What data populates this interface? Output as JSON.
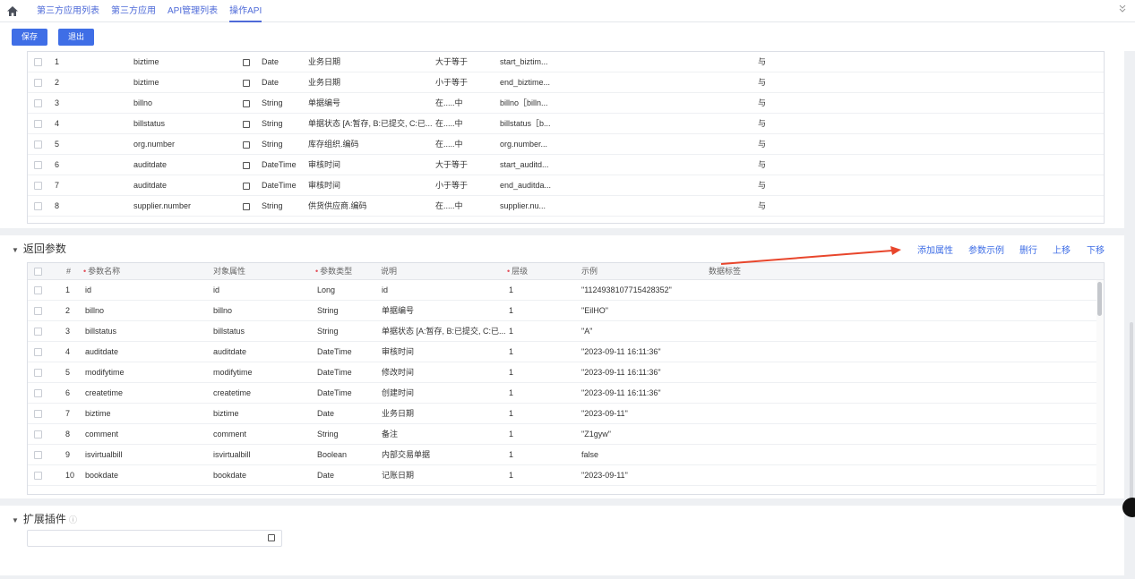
{
  "nav": {
    "tabs": [
      "第三方应用列表",
      "第三方应用",
      "API管理列表",
      "操作API"
    ]
  },
  "toolbar": {
    "save_label": "保存",
    "exit_label": "退出"
  },
  "request_rows": [
    {
      "idx": "1",
      "field": "biztime",
      "type": "Date",
      "desc": "业务日期",
      "op": "大于等于",
      "param": "start_biztim...",
      "logic": "与"
    },
    {
      "idx": "2",
      "field": "biztime",
      "type": "Date",
      "desc": "业务日期",
      "op": "小于等于",
      "param": "end_biztime...",
      "logic": "与"
    },
    {
      "idx": "3",
      "field": "billno",
      "type": "String",
      "desc": "单据编号",
      "op": "在.....中",
      "param": "billno［billn...",
      "logic": "与"
    },
    {
      "idx": "4",
      "field": "billstatus",
      "type": "String",
      "desc": "单据状态 [A:暂存, B:已提交, C:已...",
      "op": "在.....中",
      "param": "billstatus［b...",
      "logic": "与"
    },
    {
      "idx": "5",
      "field": "org.number",
      "type": "String",
      "desc": "库存组织.编码",
      "op": "在.....中",
      "param": "org.number...",
      "logic": "与"
    },
    {
      "idx": "6",
      "field": "auditdate",
      "type": "DateTime",
      "desc": "审核时间",
      "op": "大于等于",
      "param": "start_auditd...",
      "logic": "与"
    },
    {
      "idx": "7",
      "field": "auditdate",
      "type": "DateTime",
      "desc": "审核时间",
      "op": "小于等于",
      "param": "end_auditda...",
      "logic": "与"
    },
    {
      "idx": "8",
      "field": "supplier.number",
      "type": "String",
      "desc": "供货供应商.编码",
      "op": "在.....中",
      "param": "supplier.nu...",
      "logic": "与"
    }
  ],
  "return_section": {
    "title": "返回参数",
    "actions": [
      "添加属性",
      "参数示例",
      "删行",
      "上移",
      "下移"
    ],
    "columns": {
      "index": "#",
      "name": "参数名称",
      "obj_attr": "对象属性",
      "type": "参数类型",
      "desc": "说明",
      "level": "层级",
      "example": "示例",
      "tag": "数据标签"
    },
    "rows": [
      {
        "idx": "1",
        "name": "id",
        "attr": "id",
        "type": "Long",
        "desc": "id",
        "level": "1",
        "example": "\"1124938107715428352\""
      },
      {
        "idx": "2",
        "name": "billno",
        "attr": "billno",
        "type": "String",
        "desc": "单据编号",
        "level": "1",
        "example": "\"EilHO\""
      },
      {
        "idx": "3",
        "name": "billstatus",
        "attr": "billstatus",
        "type": "String",
        "desc": "单据状态 [A:暂存, B:已提交, C:已...",
        "level": "1",
        "example": "\"A\""
      },
      {
        "idx": "4",
        "name": "auditdate",
        "attr": "auditdate",
        "type": "DateTime",
        "desc": "审核时间",
        "level": "1",
        "example": "\"2023-09-11 16:11:36\""
      },
      {
        "idx": "5",
        "name": "modifytime",
        "attr": "modifytime",
        "type": "DateTime",
        "desc": "修改时间",
        "level": "1",
        "example": "\"2023-09-11 16:11:36\""
      },
      {
        "idx": "6",
        "name": "createtime",
        "attr": "createtime",
        "type": "DateTime",
        "desc": "创建时间",
        "level": "1",
        "example": "\"2023-09-11 16:11:36\""
      },
      {
        "idx": "7",
        "name": "biztime",
        "attr": "biztime",
        "type": "Date",
        "desc": "业务日期",
        "level": "1",
        "example": "\"2023-09-11\""
      },
      {
        "idx": "8",
        "name": "comment",
        "attr": "comment",
        "type": "String",
        "desc": "备注",
        "level": "1",
        "example": "\"Z1gyw\""
      },
      {
        "idx": "9",
        "name": "isvirtualbill",
        "attr": "isvirtualbill",
        "type": "Boolean",
        "desc": "内部交易单据",
        "level": "1",
        "example": "false"
      },
      {
        "idx": "10",
        "name": "bookdate",
        "attr": "bookdate",
        "type": "Date",
        "desc": "记账日期",
        "level": "1",
        "example": "\"2023-09-11\""
      }
    ]
  },
  "plugin_section": {
    "title": "扩展插件"
  },
  "colors": {
    "accent": "#3f6ee6",
    "arrow": "#e8462c",
    "required": "#e34d59"
  }
}
